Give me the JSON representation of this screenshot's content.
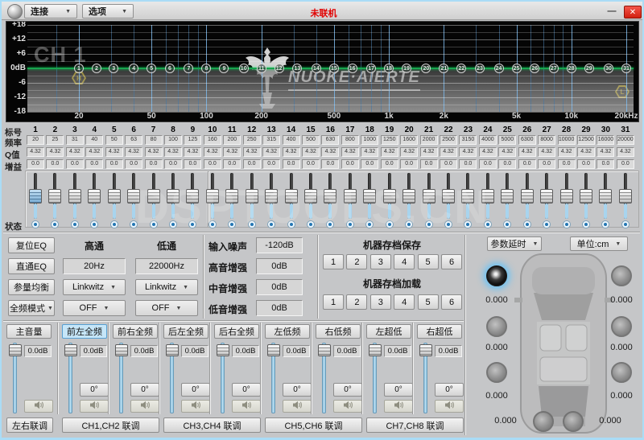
{
  "window": {
    "border_color": "#aadcf6",
    "status_color": "#e10000",
    "accent_blue": "#c6e6f8",
    "eq_line_green": "#18a54e"
  },
  "title_bar": {
    "connect_label": "连接",
    "options_label": "选项",
    "status": "未联机",
    "minimize_glyph": "—",
    "close_glyph": "✕"
  },
  "watermark": "DSPTOOLS.CN",
  "eq_graph": {
    "channel_label": "CH 1",
    "logo_text": "NUOKE·AIERTE",
    "y_labels": [
      "+18",
      "+12",
      "+6",
      "0dB",
      "-6",
      "-12",
      "-18"
    ],
    "x_ticks": [
      {
        "label": "20",
        "f": 20
      },
      {
        "label": "50",
        "f": 50
      },
      {
        "label": "100",
        "f": 100
      },
      {
        "label": "200",
        "f": 200
      },
      {
        "label": "500",
        "f": 500
      },
      {
        "label": "1k",
        "f": 1000
      },
      {
        "label": "2k",
        "f": 2000
      },
      {
        "label": "5k",
        "f": 5000
      },
      {
        "label": "10k",
        "f": 10000
      },
      {
        "label": "20kHz",
        "f": 20000
      }
    ],
    "high_pass_marker": "H",
    "low_pass_marker": "L",
    "curve": "flat 0dB"
  },
  "eq_table": {
    "row_labels": {
      "index": "标号",
      "freq": "频率",
      "q": "Q值",
      "gain": "增益",
      "status": "状态"
    },
    "bands": [
      {
        "n": "1",
        "f": 20,
        "freq": "20",
        "q": "4.32",
        "gain": "0.0"
      },
      {
        "n": "2",
        "f": 25,
        "freq": "25",
        "q": "4.32",
        "gain": "0.0"
      },
      {
        "n": "3",
        "f": 31,
        "freq": "31",
        "q": "4.32",
        "gain": "0.0"
      },
      {
        "n": "4",
        "f": 40,
        "freq": "40",
        "q": "4.32",
        "gain": "0.0"
      },
      {
        "n": "5",
        "f": 50,
        "freq": "50",
        "q": "4.32",
        "gain": "0.0"
      },
      {
        "n": "6",
        "f": 63,
        "freq": "63",
        "q": "4.32",
        "gain": "0.0"
      },
      {
        "n": "7",
        "f": 80,
        "freq": "80",
        "q": "4.32",
        "gain": "0.0"
      },
      {
        "n": "8",
        "f": 100,
        "freq": "100",
        "q": "4.32",
        "gain": "0.0"
      },
      {
        "n": "9",
        "f": 125,
        "freq": "125",
        "q": "4.32",
        "gain": "0.0"
      },
      {
        "n": "10",
        "f": 160,
        "freq": "160",
        "q": "4.32",
        "gain": "0.0"
      },
      {
        "n": "11",
        "f": 200,
        "freq": "200",
        "q": "4.32",
        "gain": "0.0"
      },
      {
        "n": "12",
        "f": 250,
        "freq": "250",
        "q": "4.32",
        "gain": "0.0"
      },
      {
        "n": "13",
        "f": 315,
        "freq": "315",
        "q": "4.32",
        "gain": "0.0"
      },
      {
        "n": "14",
        "f": 400,
        "freq": "400",
        "q": "4.32",
        "gain": "0.0"
      },
      {
        "n": "15",
        "f": 500,
        "freq": "500",
        "q": "4.32",
        "gain": "0.0"
      },
      {
        "n": "16",
        "f": 630,
        "freq": "630",
        "q": "4.32",
        "gain": "0.0"
      },
      {
        "n": "17",
        "f": 800,
        "freq": "800",
        "q": "4.32",
        "gain": "0.0"
      },
      {
        "n": "18",
        "f": 1000,
        "freq": "1000",
        "q": "4.32",
        "gain": "0.0"
      },
      {
        "n": "19",
        "f": 1250,
        "freq": "1250",
        "q": "4.32",
        "gain": "0.0"
      },
      {
        "n": "20",
        "f": 1600,
        "freq": "1600",
        "q": "4.32",
        "gain": "0.0"
      },
      {
        "n": "21",
        "f": 2000,
        "freq": "2000",
        "q": "4.32",
        "gain": "0.0"
      },
      {
        "n": "22",
        "f": 2500,
        "freq": "2500",
        "q": "4.32",
        "gain": "0.0"
      },
      {
        "n": "23",
        "f": 3150,
        "freq": "3150",
        "q": "4.32",
        "gain": "0.0"
      },
      {
        "n": "24",
        "f": 4000,
        "freq": "4000",
        "q": "4.32",
        "gain": "0.0"
      },
      {
        "n": "25",
        "f": 5000,
        "freq": "5000",
        "q": "4.32",
        "gain": "0.0"
      },
      {
        "n": "26",
        "f": 6300,
        "freq": "6300",
        "q": "4.32",
        "gain": "0.0"
      },
      {
        "n": "27",
        "f": 8000,
        "freq": "8000",
        "q": "4.32",
        "gain": "0.0"
      },
      {
        "n": "28",
        "f": 10000,
        "freq": "10000",
        "q": "4.32",
        "gain": "0.0"
      },
      {
        "n": "29",
        "f": 12500,
        "freq": "12500",
        "q": "4.32",
        "gain": "0.0"
      },
      {
        "n": "30",
        "f": 16000,
        "freq": "16000",
        "q": "4.32",
        "gain": "0.0"
      },
      {
        "n": "31",
        "f": 20000,
        "freq": "20000",
        "q": "4.32",
        "gain": "0.0"
      }
    ]
  },
  "filters": {
    "reset_eq": "复位EQ",
    "bypass_eq": "直通EQ",
    "param_eq": "参量均衡",
    "fullrange_mode": "全频模式",
    "hp_title": "高通",
    "hp_freq": "20Hz",
    "hp_type": "Linkwitz",
    "hp_slope": "OFF",
    "lp_title": "低通",
    "lp_freq": "22000Hz",
    "lp_type": "Linkwitz",
    "lp_slope": "OFF"
  },
  "levels": [
    {
      "label": "输入噪声",
      "value": "-120dB"
    },
    {
      "label": "高音增强",
      "value": "0dB"
    },
    {
      "label": "中音增强",
      "value": "0dB"
    },
    {
      "label": "低音增强",
      "value": "0dB"
    }
  ],
  "presets": {
    "save_title": "机器存档保存",
    "load_title": "机器存档加载",
    "save_buttons": [
      "1",
      "2",
      "3",
      "4",
      "5",
      "6"
    ],
    "load_buttons": [
      "1",
      "2",
      "3",
      "4",
      "5",
      "6"
    ]
  },
  "delay_panel": {
    "delay_menu": "参数延时",
    "unit_menu": "单位:cm",
    "values": {
      "front_left": "0.000",
      "front_right": "0.000",
      "mid_left": "0.000",
      "mid_right": "0.000",
      "rear_left": "0.000",
      "rear_right": "0.000",
      "sub_left": "0.000",
      "sub_right": "0.000"
    }
  },
  "channels": {
    "strips": [
      {
        "label": "主音量",
        "volume": "0.0dB",
        "phase": null,
        "active": false
      },
      {
        "label": "前左全频",
        "volume": "0.0dB",
        "phase": "0°",
        "active": true
      },
      {
        "label": "前右全频",
        "volume": "0.0dB",
        "phase": "0°",
        "active": false
      },
      {
        "label": "后左全频",
        "volume": "0.0dB",
        "phase": "0°",
        "active": false
      },
      {
        "label": "后右全频",
        "volume": "0.0dB",
        "phase": "0°",
        "active": false
      },
      {
        "label": "左低频",
        "volume": "0.0dB",
        "phase": "0°",
        "active": false
      },
      {
        "label": "右低频",
        "volume": "0.0dB",
        "phase": "0°",
        "active": false
      },
      {
        "label": "左超低",
        "volume": "0.0dB",
        "phase": "0°",
        "active": false
      },
      {
        "label": "右超低",
        "volume": "0.0dB",
        "phase": "0°",
        "active": false
      }
    ],
    "link_buttons": [
      "左右联调",
      "CH1,CH2 联调",
      "CH3,CH4 联调",
      "CH5,CH6 联调",
      "CH7,CH8 联调"
    ]
  }
}
